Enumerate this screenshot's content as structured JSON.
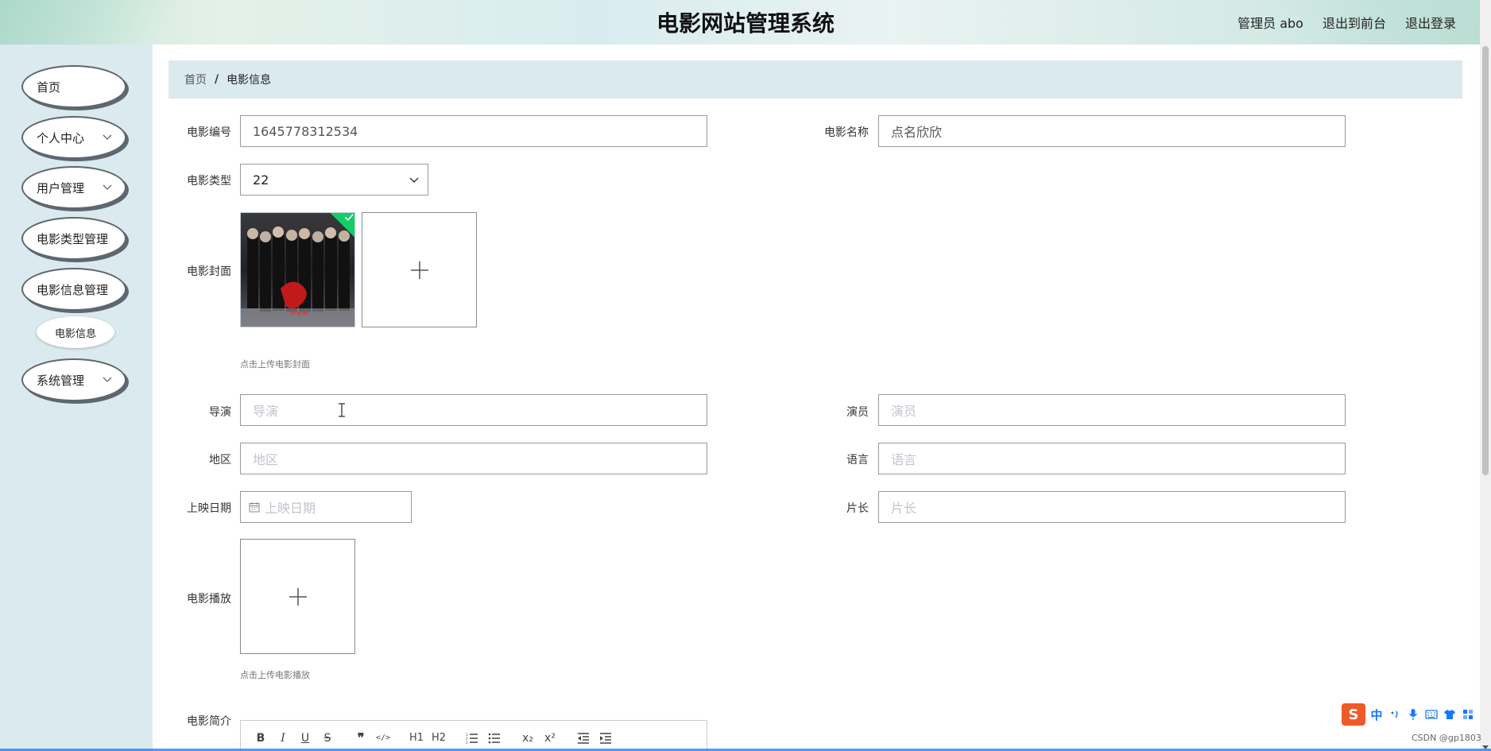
{
  "header": {
    "title": "电影网站管理系统",
    "user_label": "管理员 abo",
    "front_link": "退出到前台",
    "logout_link": "退出登录"
  },
  "sidebar": {
    "items": [
      {
        "label": "首页",
        "has_children": false
      },
      {
        "label": "个人中心",
        "has_children": true
      },
      {
        "label": "用户管理",
        "has_children": true
      },
      {
        "label": "电影类型管理",
        "has_children": false
      },
      {
        "label": "电影信息管理",
        "has_children": false
      },
      {
        "label": "系统管理",
        "has_children": true
      }
    ],
    "subitem": "电影信息"
  },
  "breadcrumb": {
    "home": "首页",
    "separator": "/",
    "current": "电影信息"
  },
  "form": {
    "movie_no": {
      "label": "电影编号",
      "value": "1645778312534"
    },
    "movie_name": {
      "label": "电影名称",
      "value": "点名欣欣"
    },
    "movie_type": {
      "label": "电影类型",
      "value": "22"
    },
    "cover": {
      "label": "电影封面",
      "hint": "点击上传电影封面"
    },
    "director": {
      "label": "导演",
      "placeholder": "导演"
    },
    "actor": {
      "label": "演员",
      "placeholder": "演员"
    },
    "region": {
      "label": "地区",
      "placeholder": "地区"
    },
    "language": {
      "label": "语言",
      "placeholder": "语言"
    },
    "release_date": {
      "label": "上映日期",
      "placeholder": "上映日期"
    },
    "duration": {
      "label": "片长",
      "placeholder": "片长"
    },
    "play": {
      "label": "电影播放",
      "hint": "点击上传电影播放"
    },
    "intro": {
      "label": "电影简介"
    }
  },
  "editor_toolbar": [
    "B",
    "I",
    "U",
    "S",
    "❞",
    "</>",
    "H1",
    "H2",
    "ol",
    "ul",
    "x₂",
    "x²",
    "outdent",
    "indent"
  ],
  "ime": {
    "logo": "S",
    "mode": "中"
  },
  "watermark": "CSDN @gp1803",
  "colors": {
    "sidebar_bg": "#dbeaee",
    "accent": "#13ce66",
    "border": "#9a9a9a"
  }
}
